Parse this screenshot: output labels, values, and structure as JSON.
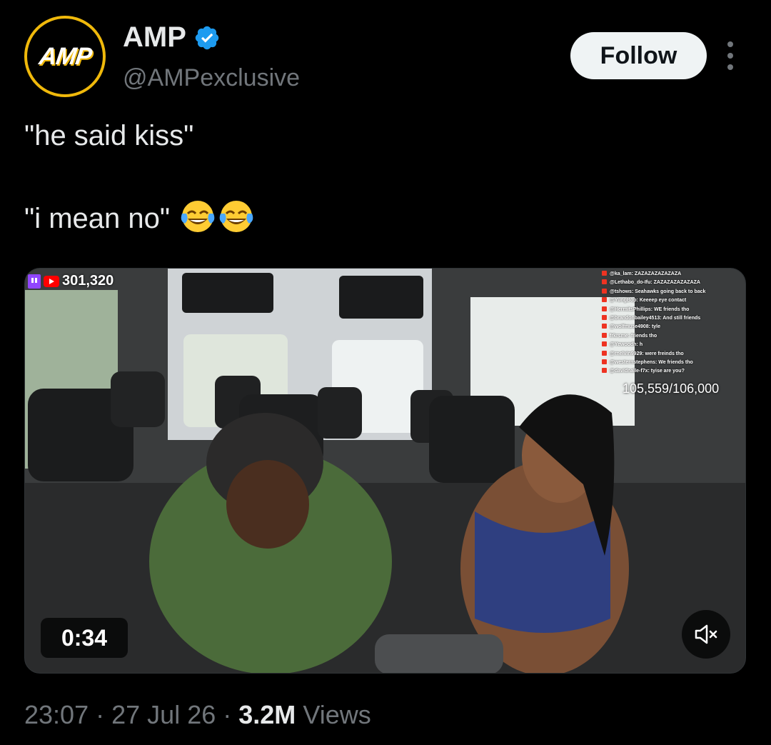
{
  "author": {
    "avatar_text": "AMP",
    "display_name": "AMP",
    "handle": "@AMPexclusive",
    "verified": true
  },
  "follow_label": "Follow",
  "tweet": {
    "line1": "\"he said kiss\"",
    "line2": "\"i mean no\"",
    "emoji": "face-with-tears-of-joy x2"
  },
  "video": {
    "viewer_count": "301,320",
    "goal_text": "105,559/106,000",
    "duration": "0:34",
    "chat": [
      "@ka_lam: ZAZAZAZAZAZAZA",
      "@Lethabo_do-Ifu: ZAZAZAZAZAZAZA",
      "@tshows: Seahawks going back to back",
      "@YungBop: Keeeep eye contact",
      "@HermitsPhillips: WE friends tho",
      "@brandonbailey4513: And still friends",
      "@wolfmuse4908: tyle",
      "frkrsme: friends tho",
      "@Yewoodh: h",
      "@rnelvin9929: were freinds tho",
      "@westernstephens: We friends tho",
      "@davidnalle-f7x: tyise are you?"
    ]
  },
  "meta": {
    "time": "23:07",
    "date": "27 Jul 26",
    "views_count": "3.2M",
    "views_label": "Views",
    "separator": "·"
  },
  "colors": {
    "background": "#000000",
    "text": "#e7e9ea",
    "muted": "#71767b",
    "verified": "#1d9bf0",
    "avatar_ring": "#f0b90b"
  }
}
